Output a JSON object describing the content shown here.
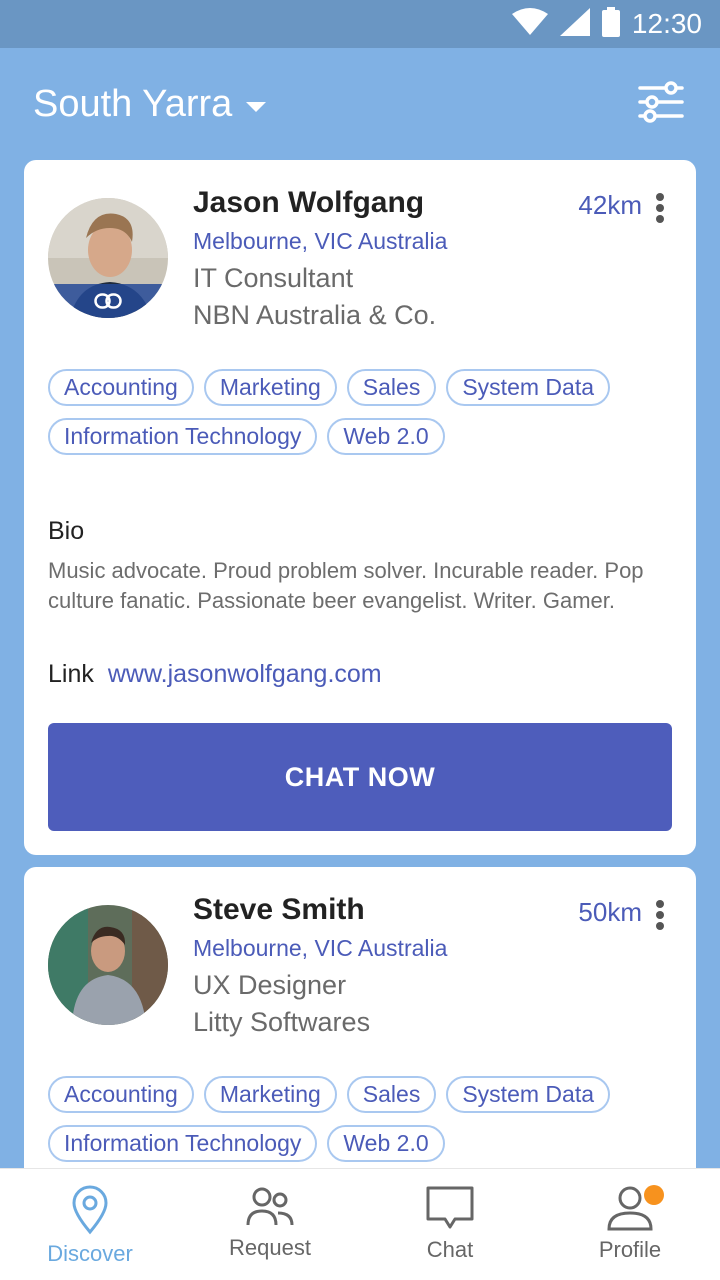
{
  "status_bar": {
    "time": "12:30"
  },
  "header": {
    "location": "South Yarra"
  },
  "profiles": [
    {
      "name": "Jason Wolfgang",
      "location": "Melbourne, VIC Australia",
      "role": "IT Consultant",
      "company": "NBN Australia & Co.",
      "distance": "42km",
      "tags": [
        "Accounting",
        "Marketing",
        "Sales",
        "System Data",
        "Information Technology",
        "Web 2.0"
      ],
      "bio_title": "Bio",
      "bio": "Music advocate. Proud problem solver. Incurable reader. Pop culture fanatic. Passionate beer evangelist. Writer. Gamer.",
      "link_label": "Link",
      "link": "www.jasonwolfgang.com",
      "cta": "CHAT NOW"
    },
    {
      "name": "Steve Smith",
      "location": "Melbourne, VIC Australia",
      "role": "UX Designer",
      "company": "Litty Softwares",
      "distance": "50km",
      "tags": [
        "Accounting",
        "Marketing",
        "Sales",
        "System Data",
        "Information Technology",
        "Web 2.0"
      ]
    }
  ],
  "nav": [
    {
      "label": "Discover",
      "icon": "location-pin-icon",
      "active": true
    },
    {
      "label": "Request",
      "icon": "users-icon",
      "active": false
    },
    {
      "label": "Chat",
      "icon": "chat-bubble-icon",
      "active": false
    },
    {
      "label": "Profile",
      "icon": "user-icon",
      "active": false,
      "badge": true
    }
  ],
  "colors": {
    "background": "#80b1e4",
    "accent": "#4e5dbb",
    "nav_active": "#6aa9df",
    "badge": "#f7921e"
  }
}
